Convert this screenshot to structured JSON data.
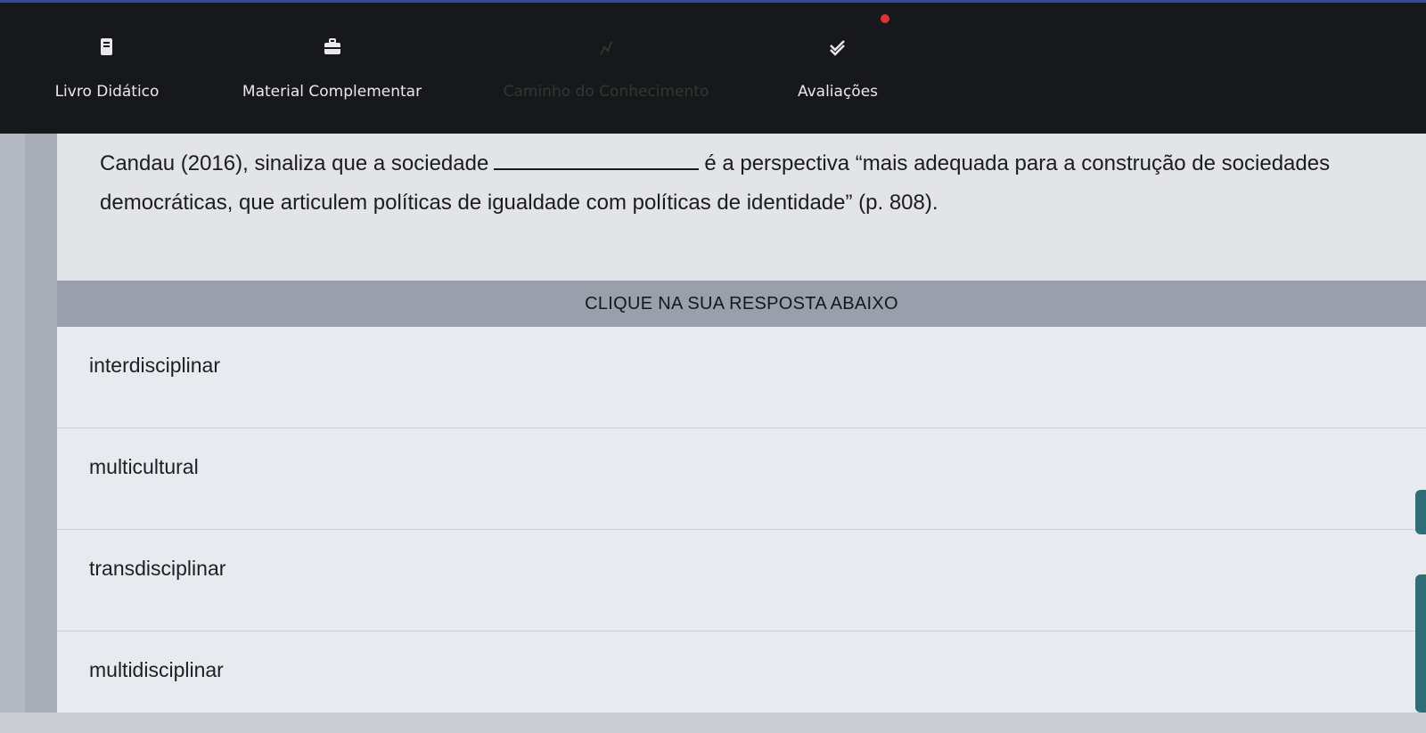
{
  "nav": {
    "items": [
      {
        "label": "Livro Didático",
        "icon": "book-icon"
      },
      {
        "label": "Material Complementar",
        "icon": "briefcase-icon"
      },
      {
        "label": "Caminho do Conhecimento",
        "icon": "path-icon"
      },
      {
        "label": "Avaliações",
        "icon": "check-double-icon"
      }
    ],
    "notification_color": "#e0303a"
  },
  "question": {
    "text_before": "Candau (2016), sinaliza que a sociedade",
    "text_after": "é a perspectiva “mais adequada para a construção de sociedades democráticas, que articulem políticas de igualdade com políticas de identidade” (p. 808)."
  },
  "answers": {
    "header": "CLIQUE NA SUA RESPOSTA ABAIXO",
    "options": [
      {
        "label": "interdisciplinar"
      },
      {
        "label": "multicultural"
      },
      {
        "label": "transdisciplinar"
      },
      {
        "label": "multidisciplinar"
      }
    ]
  },
  "colors": {
    "nav_bg": "#17181b",
    "header_bg": "#9aa0ab",
    "accent": "#2f6e79"
  }
}
